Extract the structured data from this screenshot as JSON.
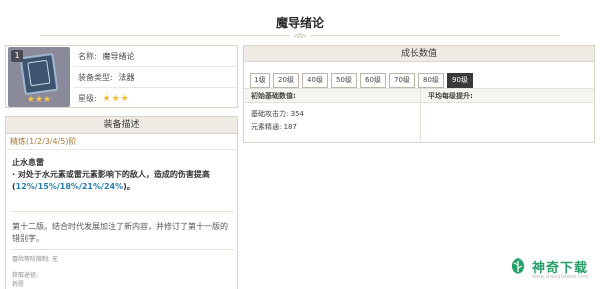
{
  "page": {
    "title": "魔导绪论"
  },
  "item": {
    "level_badge": "1",
    "stars": "★★★",
    "rows": [
      {
        "key": "名称:",
        "value": "魔导绪论"
      },
      {
        "key": "装备类型:",
        "value": "法器"
      },
      {
        "key": "星级:",
        "value": "★★★"
      }
    ]
  },
  "description": {
    "header": "装备描述",
    "refine": "精炼(1/2/3/4/5)阶",
    "effect_title": "止水息雷",
    "effect_text_prefix": "· 对处于水元素或雷元素影响下的敌人，造成的伤害提高(",
    "effect_text_values": "12%/15%/18%/21%/24%",
    "effect_text_suffix": ")。",
    "lore": "第十二版。结合时代发展加注了新内容，并修订了第十一版的错别字。",
    "ascension_limit": "冒险等阶限制: 无",
    "source_label": "获取途径:",
    "source_value": "祈愿"
  },
  "growth": {
    "header": "成长数值",
    "levels": [
      "1级",
      "20级",
      "40级",
      "50级",
      "60级",
      "70级",
      "80级",
      "90级"
    ],
    "active_level": "90级",
    "base_header": "初始基础数值:",
    "avg_header": "平均每级提升:",
    "atk_label": "基础攻击力:",
    "atk_value": "354",
    "em_label": "元素精通:",
    "em_value": "187"
  },
  "watermark": {
    "name": "神奇下载",
    "url": "www.shenqixiazai.com"
  },
  "colors": {
    "accent_blue": "#2a7fb0",
    "refine_gold": "#a47a3a",
    "star_gold": "#f1b930",
    "watermark_green": "#27a06a",
    "active_btn": "#3a3a3a"
  }
}
